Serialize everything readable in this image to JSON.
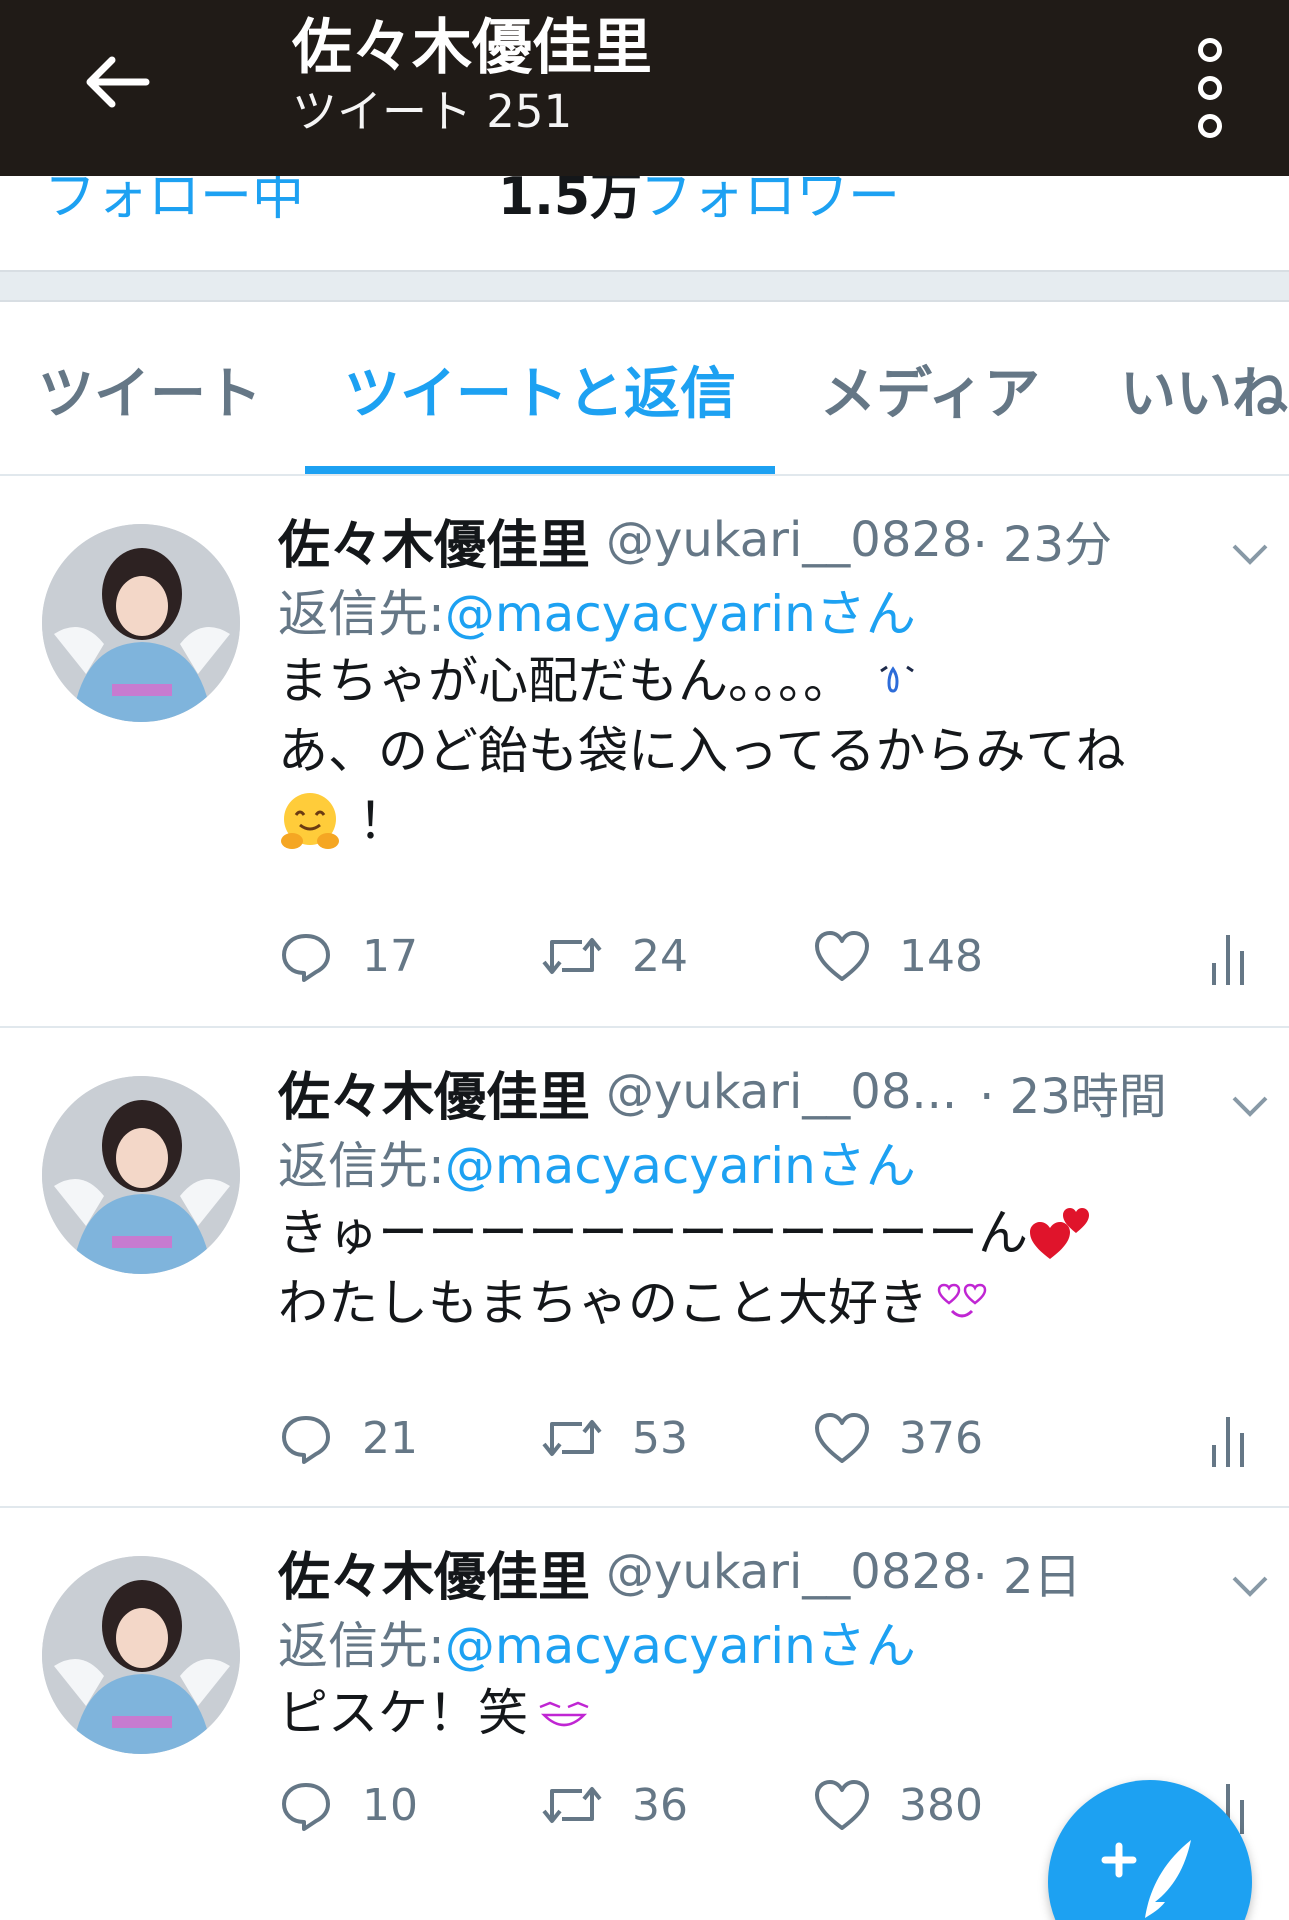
{
  "header": {
    "title": "佐々木優佳里",
    "subtitle": "ツイート 251"
  },
  "profile_strip": {
    "left_fragment": "フォロー中",
    "right_count": "1.5万",
    "right_label": "フォロワー"
  },
  "tabs": [
    {
      "label": "ツイート",
      "active": false
    },
    {
      "label": "ツイートと返信",
      "active": true
    },
    {
      "label": "メディア",
      "active": false
    },
    {
      "label": "いいね",
      "active": false
    }
  ],
  "colors": {
    "accent": "#1da1f2",
    "header_bg": "#201b17",
    "secondary_text": "#657786"
  },
  "tweets": [
    {
      "name": "佐々木優佳里",
      "handle": "@yukari__0828",
      "time": " · 23分",
      "reply_prefix": "返信先: ",
      "reply_to": "@macyacyarinさん",
      "lines": [
        "まちゃが心配だもん。。。。",
        "あ、のど飴も袋に入ってるからみてね",
        "！"
      ],
      "emojis": [
        "tears-emoji",
        "hugging-face-emoji"
      ],
      "replies": "17",
      "retweets": "24",
      "likes": "148"
    },
    {
      "name": "佐々木優佳里",
      "handle": "@yukari__08...",
      "time": " · 23時間",
      "reply_prefix": "返信先: ",
      "reply_to": "@macyacyarinさん",
      "lines": [
        "きゅーーーーーーーーーーーーん",
        "わたしもまちゃのこと大好き"
      ],
      "emojis": [
        "two-hearts-emoji",
        "heart-eyes-emoji"
      ],
      "replies": "21",
      "retweets": "53",
      "likes": "376"
    },
    {
      "name": "佐々木優佳里",
      "handle": "@yukari__0828",
      "time": " · 2日",
      "reply_prefix": "返信先: ",
      "reply_to": "@macyacyarinさん",
      "lines": [
        "ピスケ！笑"
      ],
      "emojis": [
        "laughing-face-emoji"
      ],
      "replies": "10",
      "retweets": "36",
      "likes": "380"
    }
  ],
  "icons": {
    "back": "back-arrow-icon",
    "more": "more-vertical-icon",
    "reply": "reply-icon",
    "retweet": "retweet-icon",
    "like": "heart-icon",
    "analytics": "analytics-icon",
    "compose": "compose-tweet-icon"
  }
}
